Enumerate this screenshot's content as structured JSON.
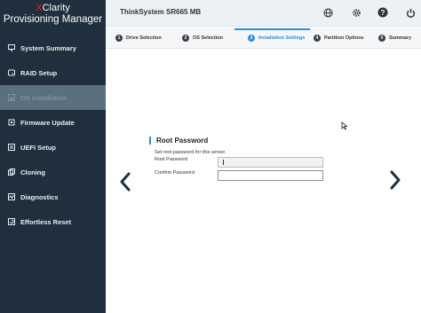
{
  "brand": {
    "line1_prefix": "X",
    "line1_rest": "Clarity",
    "line2": "Provisioning Manager"
  },
  "sidebar": {
    "items": [
      {
        "label": "System Summary",
        "icon": "monitor-icon"
      },
      {
        "label": "RAID Setup",
        "icon": "disk-icon"
      },
      {
        "label": "OS Installation",
        "icon": "disc-icon",
        "active": true
      },
      {
        "label": "Firmware Update",
        "icon": "chip-icon"
      },
      {
        "label": "UEFI Setup",
        "icon": "settings-panel-icon"
      },
      {
        "label": "Cloning",
        "icon": "copy-icon"
      },
      {
        "label": "Diagnostics",
        "icon": "diagnostics-icon"
      },
      {
        "label": "Effortless Reset",
        "icon": "reset-icon"
      }
    ]
  },
  "header": {
    "title": "ThinkSystem SR665 MB",
    "icons": [
      "globe-icon",
      "gear-icon",
      "help-icon",
      "power-icon"
    ]
  },
  "steps": [
    {
      "num": "1",
      "label": "Drive Selection"
    },
    {
      "num": "2",
      "label": "OS Selection"
    },
    {
      "num": "3",
      "label": "Installation Settings",
      "active": true
    },
    {
      "num": "4",
      "label": "Partition Options"
    },
    {
      "num": "5",
      "label": "Summary"
    }
  ],
  "form": {
    "title": "Root Password",
    "description": "Set root password for this server.",
    "password_label": "Root Password",
    "password_value": "",
    "confirm_label": "Confirm Password",
    "confirm_value": ""
  },
  "colors": {
    "sidebar_bg": "#1f2f3d",
    "accent": "#2d8fd5",
    "brand_red": "#e2231a",
    "active_item": "#5a6f80"
  }
}
